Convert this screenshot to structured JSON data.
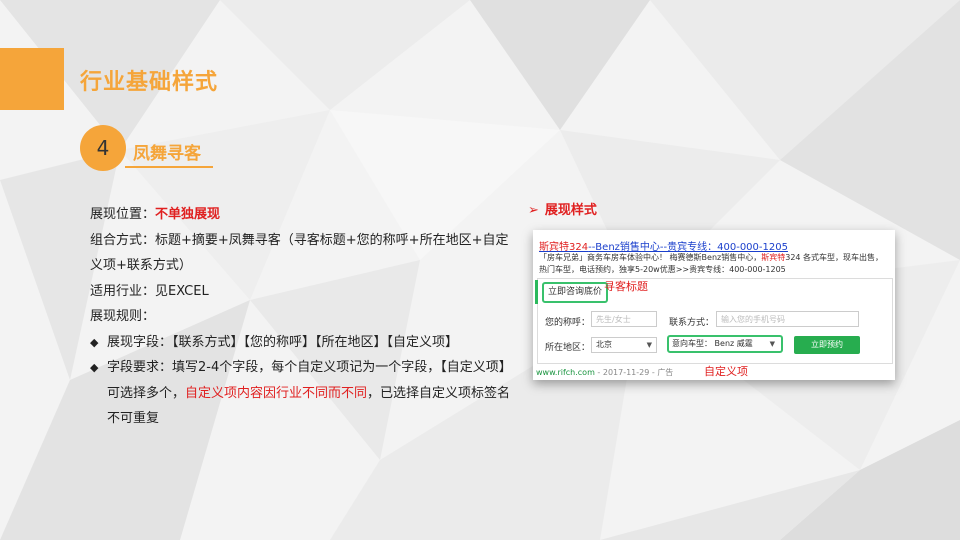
{
  "slide": {
    "title": "行业基础样式",
    "section_number": "4",
    "section_title": "凤舞寻客"
  },
  "body": {
    "position_label": "展现位置：",
    "position_value": "不单独展现",
    "composition_1": "组合方式：标题+摘要+凤舞寻客（寻客标题+您的称呼+所在地区+自定",
    "composition_2": "义项+联系方式）",
    "industry": "适用行业：见EXCEL",
    "rules_heading": "展现规则：",
    "bullet_1": "展现字段：【联系方式】【您的称呼】【所在地区】【自定义项】",
    "bullet_2_a": "字段要求：填写2-4个字段，每个自定义项记为一个字段，【自定义项】",
    "bullet_2_b": "可选择多个，",
    "bullet_2_red": "自定义项内容因行业不同而不同",
    "bullet_2_c": "，已选择自定义项标签名",
    "bullet_2_d": "不可重复",
    "bullet_marker": "◆"
  },
  "preview": {
    "heading_marker": "➢",
    "heading": "展现样式",
    "ad_title_red": "斯宾特324",
    "ad_title_rest": "--Benz销售中心--贵宾专线：400-000-1205",
    "ad_desc_1": "「房车兄弟」商务车房车体验中心！ 梅赛德斯Benz销售中心，",
    "ad_desc_red": "斯宾特",
    "ad_desc_2": "324 各式车型，现车出售，热门车型，电话预约，独享5-20w优惠>>贵宾专线：400-000-1205",
    "cta_title": "立即咨询底价",
    "cta_note": "寻客标题",
    "name_label": "您的称呼：",
    "name_placeholder": "先生/女士",
    "contact_label": "联系方式：",
    "contact_placeholder": "输入您的手机号码",
    "region_label": "所在地区：",
    "region_value": "北京",
    "custom_label": "意向车型：",
    "custom_value": "Benz 威霆",
    "submit_label": "立即预约",
    "footer_url": "www.rifch.com",
    "footer_rest": " - 2017-11-29 - 广告",
    "custom_note": "自定义项"
  },
  "colors": {
    "accent": "#f5a53a",
    "highlight_red": "#e02020",
    "cta_green": "#27ad4f",
    "link_blue": "#1a3fcc"
  }
}
